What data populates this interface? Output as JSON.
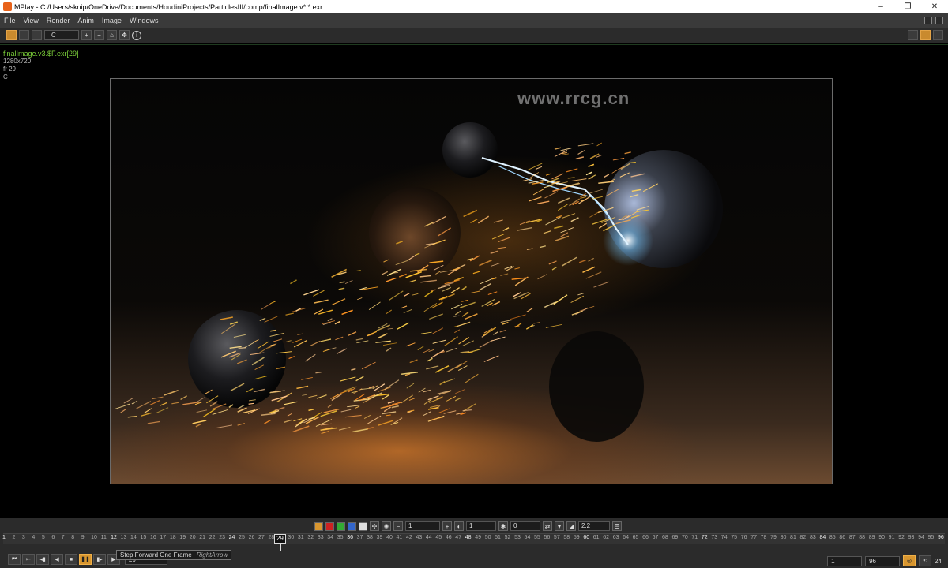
{
  "window": {
    "title": "MPlay - C:/Users/sknip/OneDrive/Documents/HoudiniProjects/ParticlesIII/comp/finalImage.v*.*.exr",
    "min_glyph": "–",
    "max_glyph": "❐",
    "close_glyph": "✕"
  },
  "menu": {
    "items": [
      "File",
      "View",
      "Render",
      "Anim",
      "Image",
      "Windows"
    ]
  },
  "toolbar": {
    "channel": "C",
    "info_glyph": "i"
  },
  "viewer": {
    "filename": "finalImage.v3.$F.exr[29]",
    "resolution": "1280x720",
    "frame_info": "fr 29",
    "channel": "C"
  },
  "watermark": "www.rrcg.cn",
  "display": {
    "frame_value": "1",
    "gamma_value": "1",
    "offset_value": "0",
    "lut_value": "2.2"
  },
  "timeline": {
    "ticks": [
      "1",
      "2",
      "3",
      "4",
      "5",
      "6",
      "7",
      "8",
      "9",
      "10",
      "11",
      "12",
      "13",
      "14",
      "15",
      "16",
      "17",
      "18",
      "19",
      "20",
      "21",
      "22",
      "23",
      "24",
      "25",
      "26",
      "27",
      "28",
      "29",
      "30",
      "31",
      "32",
      "33",
      "34",
      "35",
      "36",
      "37",
      "38",
      "39",
      "40",
      "41",
      "42",
      "43",
      "44",
      "45",
      "46",
      "47",
      "48",
      "49",
      "50",
      "51",
      "52",
      "53",
      "54",
      "55",
      "56",
      "57",
      "58",
      "59",
      "60",
      "61",
      "62",
      "63",
      "64",
      "65",
      "66",
      "67",
      "68",
      "69",
      "70",
      "71",
      "72",
      "73",
      "74",
      "75",
      "76",
      "77",
      "78",
      "79",
      "80",
      "81",
      "82",
      "83",
      "84",
      "85",
      "86",
      "87",
      "88",
      "89",
      "90",
      "91",
      "92",
      "93",
      "94",
      "95",
      "96"
    ],
    "current_frame": "29"
  },
  "transport": {
    "frame": "29"
  },
  "tooltip": {
    "text": "Step Forward One Frame",
    "shortcut": "RightArrow"
  },
  "range": {
    "start": "1",
    "end": "96",
    "fps": "24"
  },
  "colors": {
    "accent": "#d8962f",
    "filename_green": "#7cd13a"
  }
}
